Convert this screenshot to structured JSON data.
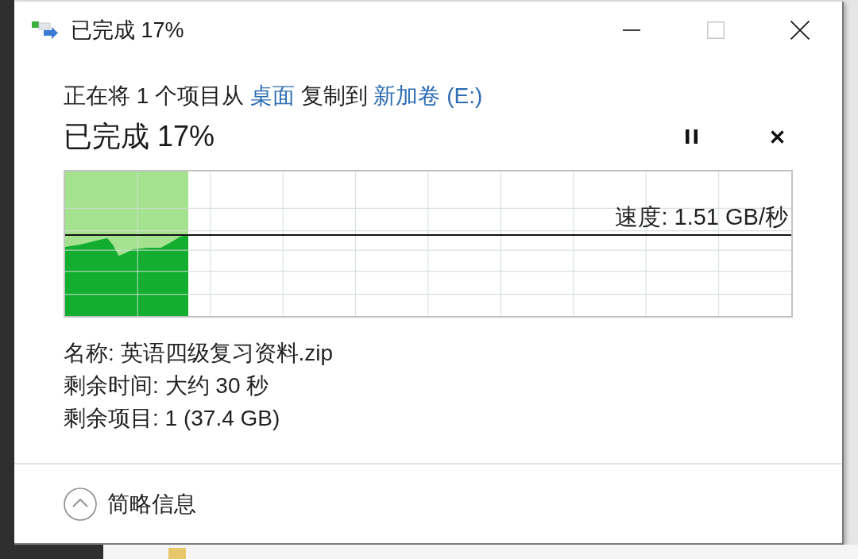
{
  "window": {
    "title": "已完成 17%",
    "title_buttons": [
      {
        "kind": "minimize",
        "disabled": false
      },
      {
        "kind": "maximize",
        "disabled": true
      },
      {
        "kind": "close",
        "disabled": false
      }
    ]
  },
  "description": [
    {
      "kind": "text",
      "text": "正在将 1 个项目从"
    },
    {
      "kind": "link",
      "text": "桌面"
    },
    {
      "kind": "text",
      "text": "复制到"
    },
    {
      "kind": "link",
      "text": "新加卷 (E:)"
    }
  ],
  "progress": {
    "heading": "已完成 17%",
    "paused": false,
    "level": 0.17,
    "speed": "速度: 1.51 GB/秒"
  },
  "details": [
    {
      "label": "名称:",
      "value": "英语四级复习资料.zip"
    },
    {
      "label": "剩余时间:",
      "value": "大约 30 秒"
    },
    {
      "label": "剩余项目:",
      "value": "1 (37.4 GB)"
    }
  ],
  "footer": {
    "toggle": "简略信息",
    "expanded": true
  }
}
